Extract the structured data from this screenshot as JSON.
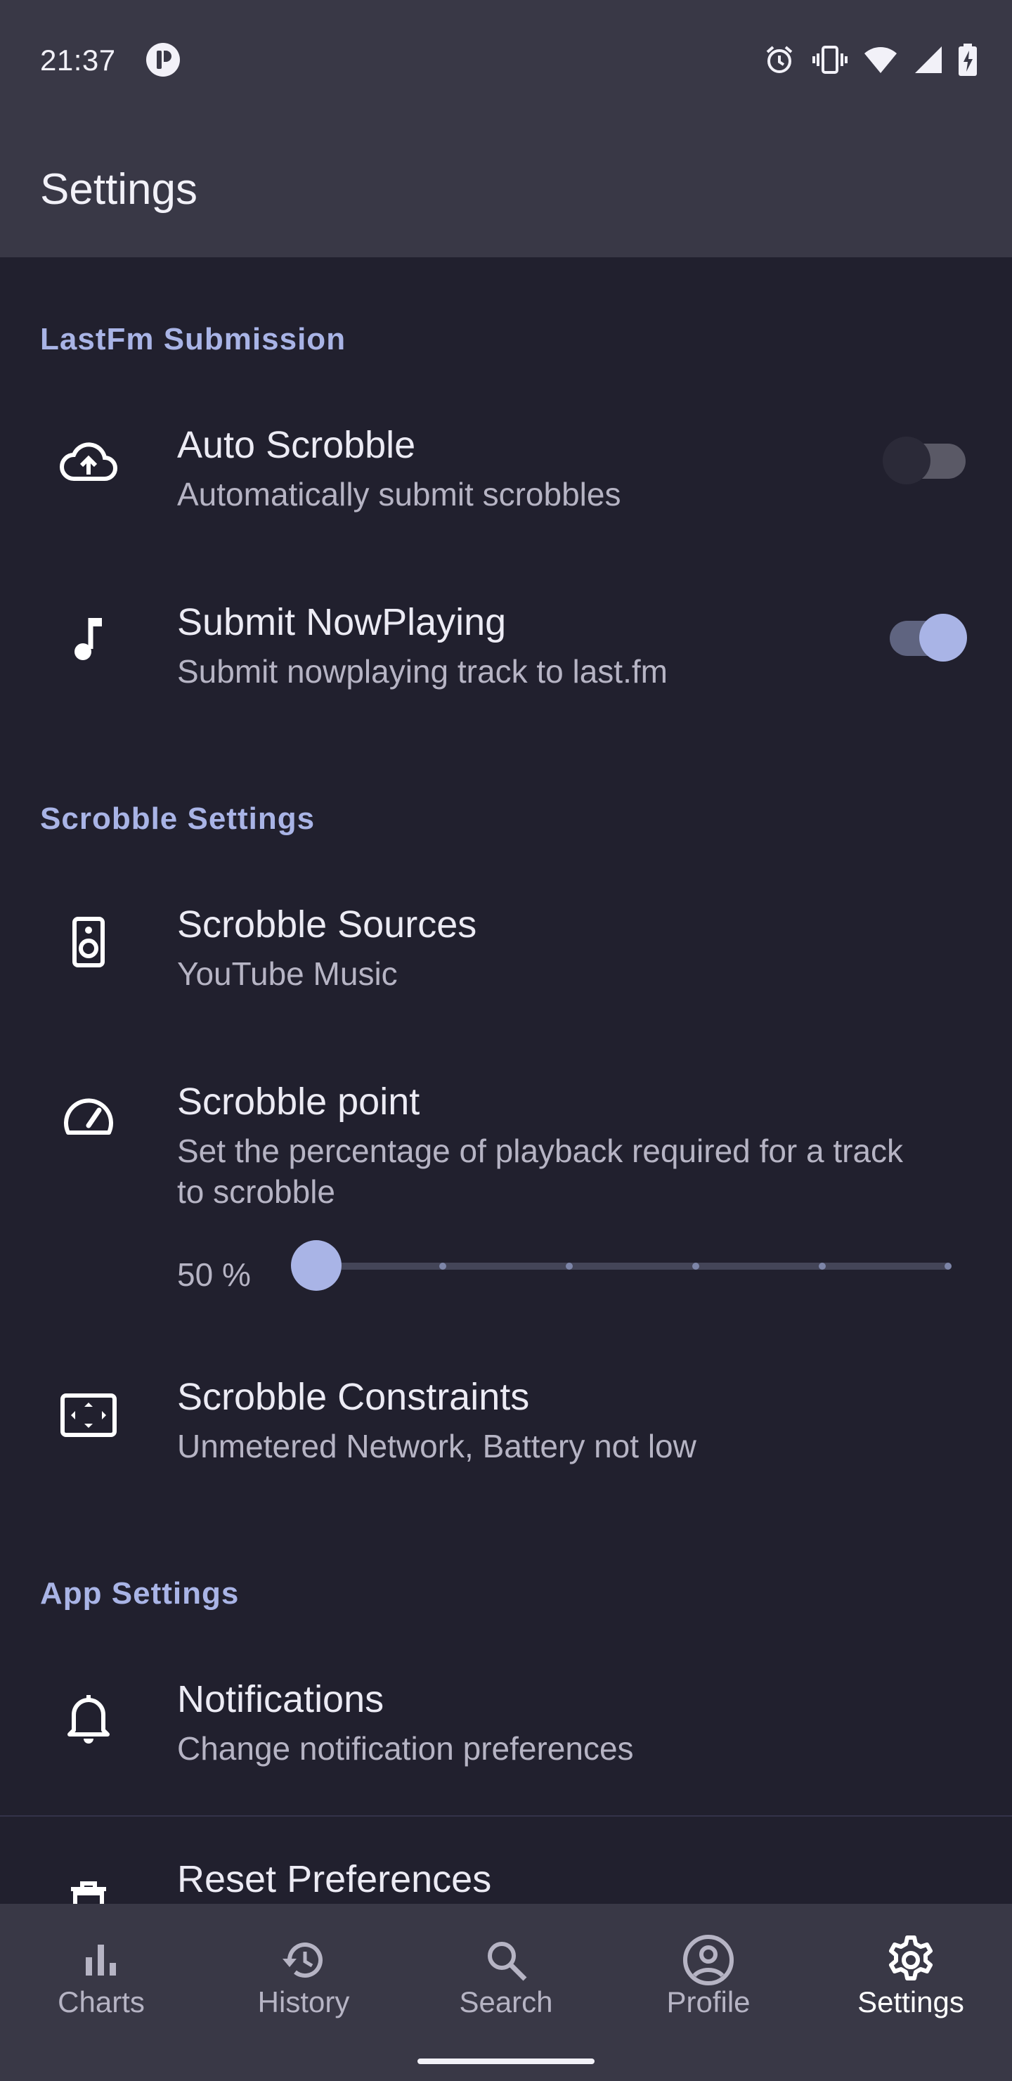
{
  "status_bar": {
    "time": "21:37"
  },
  "app_bar": {
    "title": "Settings"
  },
  "sections": {
    "lastfm": {
      "header": "LastFm Submission"
    },
    "scrobble": {
      "header": "Scrobble Settings"
    },
    "app": {
      "header": "App Settings"
    }
  },
  "prefs": {
    "auto_scrobble": {
      "title": "Auto Scrobble",
      "summary": "Automatically submit scrobbles",
      "enabled": false
    },
    "submit_nowplaying": {
      "title": "Submit NowPlaying",
      "summary": "Submit nowplaying track to last.fm",
      "enabled": true
    },
    "scrobble_sources": {
      "title": "Scrobble Sources",
      "summary": "YouTube Music"
    },
    "scrobble_point": {
      "title": "Scrobble point",
      "summary": "Set the percentage of playback required for a track to scrobble",
      "value_label": "50 %",
      "value_fraction": 0.0
    },
    "scrobble_constraints": {
      "title": "Scrobble Constraints",
      "summary": "Unmetered Network, Battery not low"
    },
    "notifications": {
      "title": "Notifications",
      "summary": "Change notification preferences"
    },
    "reset_preferences": {
      "title": "Reset Preferences"
    }
  },
  "bottom_nav": {
    "items": [
      {
        "label": "Charts",
        "icon": "bar-chart-icon"
      },
      {
        "label": "History",
        "icon": "history-icon"
      },
      {
        "label": "Search",
        "icon": "search-icon"
      },
      {
        "label": "Profile",
        "icon": "account-circle-icon"
      },
      {
        "label": "Settings",
        "icon": "gear-icon"
      }
    ],
    "active": "Settings"
  },
  "colors": {
    "background": "#21202e",
    "surface": "#393846",
    "accent": "#a9b4e6",
    "switch_off_track": "#5a5966",
    "switch_off_thumb": "#2b2a38"
  }
}
